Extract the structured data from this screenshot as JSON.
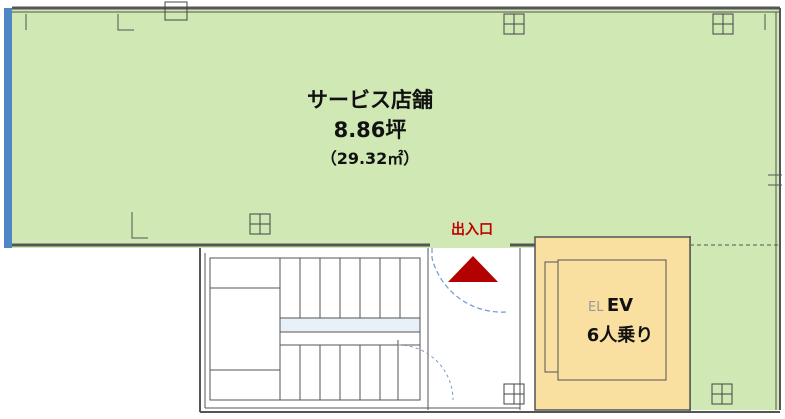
{
  "shop": {
    "name": "サービス店舗",
    "area_tsubo": "8.86坪",
    "area_sqm": "（29.32㎡）",
    "fill_color": "#cfe8b4"
  },
  "entrance": {
    "label": "出入口",
    "label_color": "#c00000",
    "arrow_color": "#b30000"
  },
  "elevator": {
    "label": "EV",
    "faint_label": "EL",
    "capacity": "6人乗り",
    "fill_color": "#f9dfa0"
  },
  "stairs": {
    "tread_count": 7
  }
}
